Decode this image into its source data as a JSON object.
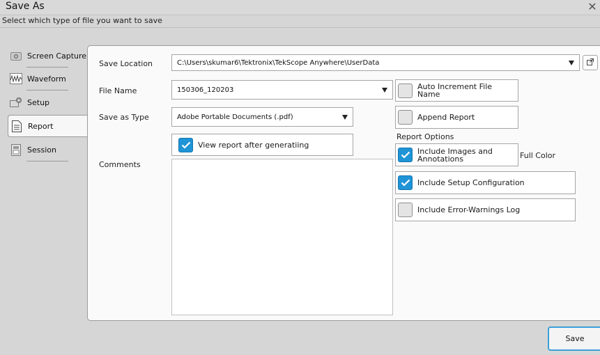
{
  "window": {
    "title": "Save As",
    "close_glyph": "✕"
  },
  "subtitle": "Select which type of file you want to save",
  "sidebar": {
    "items": [
      {
        "label": "Screen Capture",
        "icon": "camera-icon",
        "active": false
      },
      {
        "label": "Waveform",
        "icon": "waveform-icon",
        "active": false
      },
      {
        "label": "Setup",
        "icon": "setup-icon",
        "active": false
      },
      {
        "label": "Report",
        "icon": "document-icon",
        "active": true
      },
      {
        "label": "Session",
        "icon": "session-icon",
        "active": false
      }
    ]
  },
  "form": {
    "save_location_label": "Save Location",
    "save_location_value": "C:\\Users\\skumar6\\Tektronix\\TekScope Anywhere\\UserData",
    "file_name_label": "File Name",
    "file_name_value": "150306_120203",
    "save_as_type_label": "Save as Type",
    "save_as_type_value": "Adobe Portable Documents (.pdf)",
    "view_report_label": "View report after generatiing",
    "view_report_checked": true,
    "comments_label": "Comments",
    "comments_value": ""
  },
  "options": {
    "auto_increment_label_1": "Auto Increment File",
    "auto_increment_label_2": "Name",
    "auto_increment_checked": false,
    "append_report_label": "Append Report",
    "append_report_checked": false,
    "report_options_heading": "Report Options",
    "include_images_label_1": "Include Images and",
    "include_images_label_2": "Annotations",
    "include_images_checked": true,
    "full_color_label": "Full Color",
    "include_setup_label": "Include Setup Configuration",
    "include_setup_checked": true,
    "include_errors_label": "Include Error-Warnings Log",
    "include_errors_checked": false
  },
  "buttons": {
    "save_label": "Save"
  },
  "colors": {
    "accent": "#1f94d6",
    "focus_border": "#3aa0d8"
  }
}
